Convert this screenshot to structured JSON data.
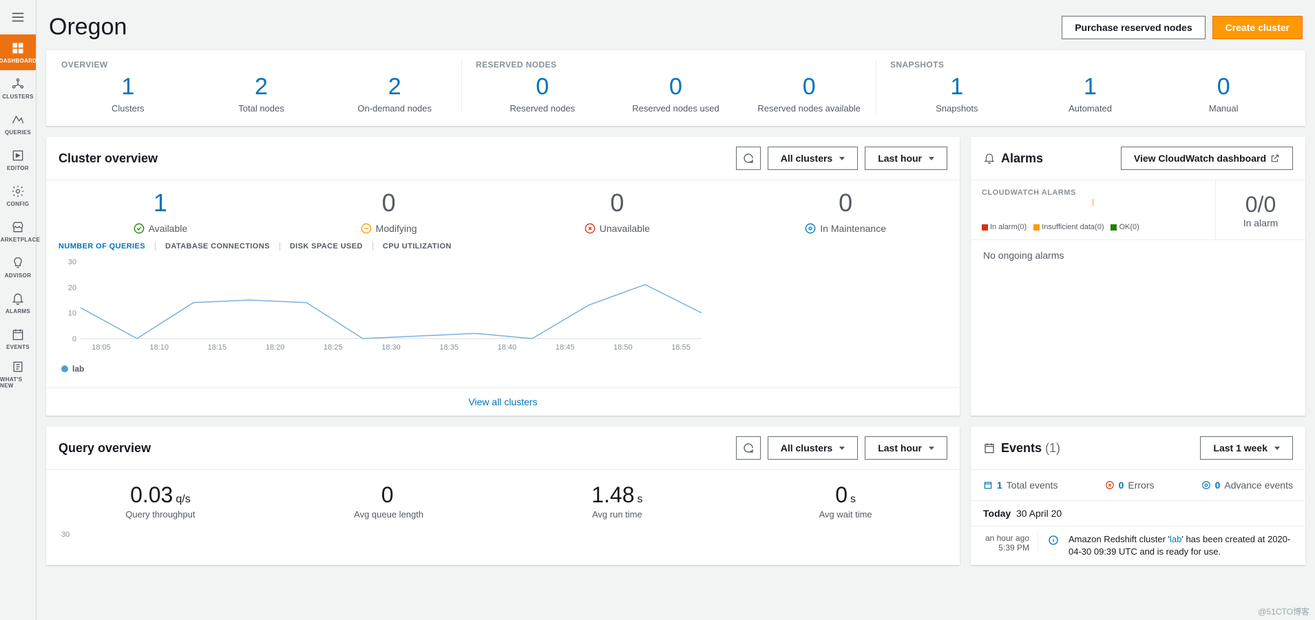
{
  "nav": {
    "items": [
      {
        "label": "DASHBOARD"
      },
      {
        "label": "CLUSTERS"
      },
      {
        "label": "QUERIES"
      },
      {
        "label": "EDITOR"
      },
      {
        "label": "CONFIG"
      },
      {
        "label": "MARKETPLACE"
      },
      {
        "label": "ADVISOR"
      },
      {
        "label": "ALARMS"
      },
      {
        "label": "EVENTS"
      },
      {
        "label": "WHAT'S NEW"
      }
    ]
  },
  "header": {
    "title": "Oregon",
    "purchase": "Purchase reserved nodes",
    "create": "Create cluster"
  },
  "summary": {
    "overview_label": "OVERVIEW",
    "reserved_label": "RESERVED NODES",
    "snapshots_label": "SNAPSHOTS",
    "overview": [
      {
        "v": "1",
        "c": "Clusters"
      },
      {
        "v": "2",
        "c": "Total nodes"
      },
      {
        "v": "2",
        "c": "On-demand nodes"
      }
    ],
    "reserved": [
      {
        "v": "0",
        "c": "Reserved nodes"
      },
      {
        "v": "0",
        "c": "Reserved nodes used"
      },
      {
        "v": "0",
        "c": "Reserved nodes available"
      }
    ],
    "snapshots": [
      {
        "v": "1",
        "c": "Snapshots"
      },
      {
        "v": "1",
        "c": "Automated"
      },
      {
        "v": "0",
        "c": "Manual"
      }
    ]
  },
  "cluster_overview": {
    "title": "Cluster overview",
    "all": "All clusters",
    "last": "Last hour",
    "stats": [
      {
        "v": "1",
        "c": "Available",
        "blue": true
      },
      {
        "v": "0",
        "c": "Modifying"
      },
      {
        "v": "0",
        "c": "Unavailable"
      },
      {
        "v": "0",
        "c": "In Maintenance"
      }
    ],
    "tabs": [
      "NUMBER OF QUERIES",
      "DATABASE CONNECTIONS",
      "DISK SPACE USED",
      "CPU UTILIZATION"
    ],
    "legend": "lab",
    "view_all": "View all clusters"
  },
  "chart_data": {
    "type": "line",
    "title": "",
    "xlabel": "",
    "ylabel": "",
    "ylim": [
      0,
      30
    ],
    "yticks": [
      0,
      10,
      20,
      30
    ],
    "categories": [
      "18:05",
      "18:10",
      "18:15",
      "18:20",
      "18:25",
      "18:30",
      "18:35",
      "18:40",
      "18:45",
      "18:50",
      "18:55"
    ],
    "series": [
      {
        "name": "lab",
        "values": [
          12,
          0,
          14,
          15,
          14,
          0,
          1,
          2,
          0,
          13,
          21,
          10
        ]
      }
    ]
  },
  "query_overview": {
    "title": "Query overview",
    "all": "All clusters",
    "last": "Last hour",
    "stats": [
      {
        "v": "0.03",
        "u": "q/s",
        "c": "Query throughput"
      },
      {
        "v": "0",
        "u": "",
        "c": "Avg queue length"
      },
      {
        "v": "1.48",
        "u": "s",
        "c": "Avg run time"
      },
      {
        "v": "0",
        "u": "s",
        "c": "Avg wait time"
      }
    ],
    "ytick": "30"
  },
  "alarms": {
    "title": "Alarms",
    "view": "View CloudWatch dashboard",
    "cw_title": "CLOUDWATCH ALARMS",
    "legend": [
      {
        "color": "#d13212",
        "label": "In alarm(0)"
      },
      {
        "color": "#ff9900",
        "label": "Insufficient data(0)"
      },
      {
        "color": "#1d8102",
        "label": "OK(0)"
      }
    ],
    "big": "0/0",
    "sub": "In alarm",
    "empty": "No ongoing alarms"
  },
  "events": {
    "title": "Events",
    "count": "(1)",
    "last": "Last 1 week",
    "totals": [
      {
        "v": "1",
        "c": "Total events"
      },
      {
        "v": "0",
        "c": "Errors"
      },
      {
        "v": "0",
        "c": "Advance events"
      }
    ],
    "today_label": "Today",
    "today": "30 April 20",
    "row": {
      "ago": "an hour ago",
      "time": "5:39 PM",
      "pre": "Amazon Redshift cluster '",
      "link": "lab",
      "post": "' has been created at 2020-04-30 09:39 UTC and is ready for use."
    }
  },
  "watermark": "@51CTO博客"
}
